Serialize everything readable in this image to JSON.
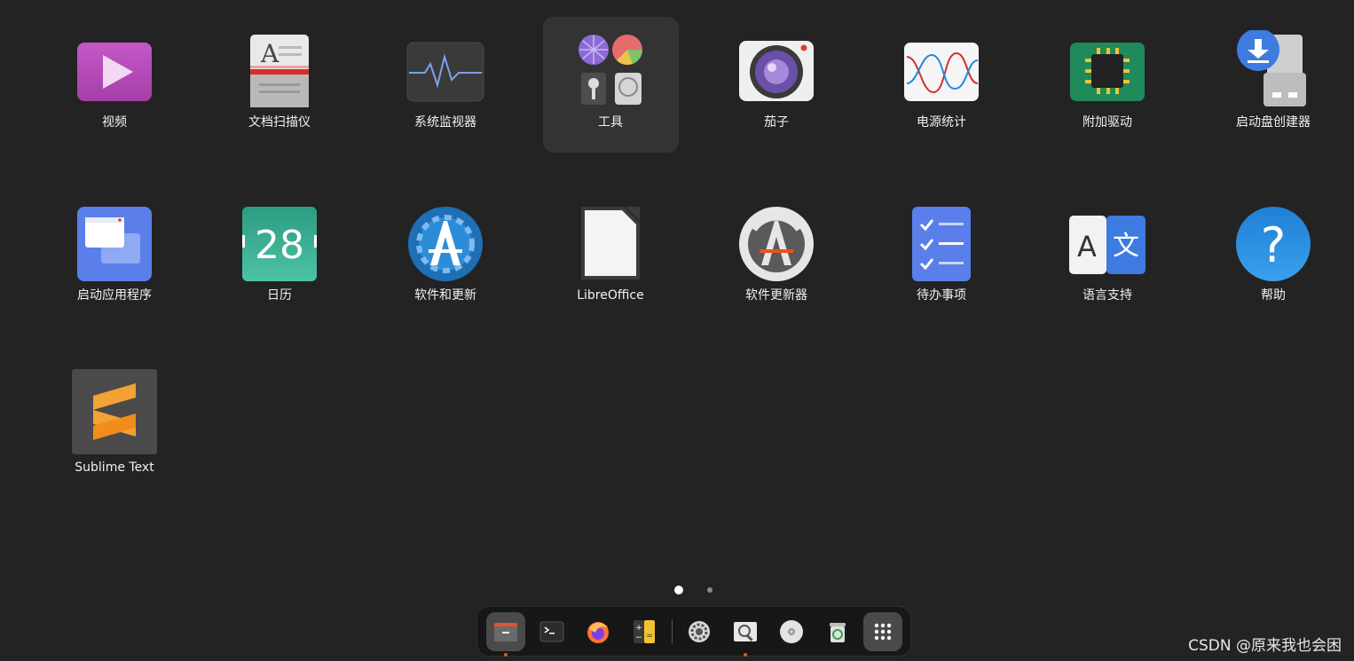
{
  "apps": [
    {
      "label": "视频",
      "icon": "video-player-icon"
    },
    {
      "label": "文档扫描仪",
      "icon": "document-scanner-icon"
    },
    {
      "label": "系统监视器",
      "icon": "system-monitor-icon"
    },
    {
      "label": "工具",
      "icon": "utilities-folder-icon"
    },
    {
      "label": "茄子",
      "icon": "cheese-camera-icon"
    },
    {
      "label": "电源统计",
      "icon": "power-statistics-icon"
    },
    {
      "label": "附加驱动",
      "icon": "additional-drivers-icon"
    },
    {
      "label": "启动盘创建器",
      "icon": "startup-disk-creator-icon"
    },
    {
      "label": "启动应用程序",
      "icon": "startup-applications-icon"
    },
    {
      "label": "日历",
      "icon": "calendar-icon",
      "day": "28"
    },
    {
      "label": "软件和更新",
      "icon": "software-properties-icon"
    },
    {
      "label": "LibreOffice",
      "icon": "libreoffice-icon"
    },
    {
      "label": "软件更新器",
      "icon": "software-updater-icon"
    },
    {
      "label": "待办事项",
      "icon": "todo-icon"
    },
    {
      "label": "语言支持",
      "icon": "language-support-icon",
      "glyphs": [
        "A",
        "文"
      ]
    },
    {
      "label": "帮助",
      "icon": "help-icon",
      "glyph": "?"
    },
    {
      "label": "Sublime Text",
      "icon": "sublime-text-icon"
    }
  ],
  "pages": {
    "count": 2,
    "current": 1
  },
  "dock": [
    {
      "name": "files-icon",
      "running": true,
      "selected": true
    },
    {
      "name": "terminal-icon",
      "running": false
    },
    {
      "name": "firefox-icon",
      "running": false
    },
    {
      "name": "calculator-icon",
      "running": false
    },
    {
      "name": "settings-icon",
      "running": false
    },
    {
      "name": "image-viewer-icon",
      "running": true
    },
    {
      "name": "disc-icon",
      "running": false
    },
    {
      "name": "trash-icon",
      "running": false
    },
    {
      "name": "show-applications-icon",
      "running": false,
      "selected": true
    }
  ],
  "watermark": "CSDN @原来我也会困"
}
